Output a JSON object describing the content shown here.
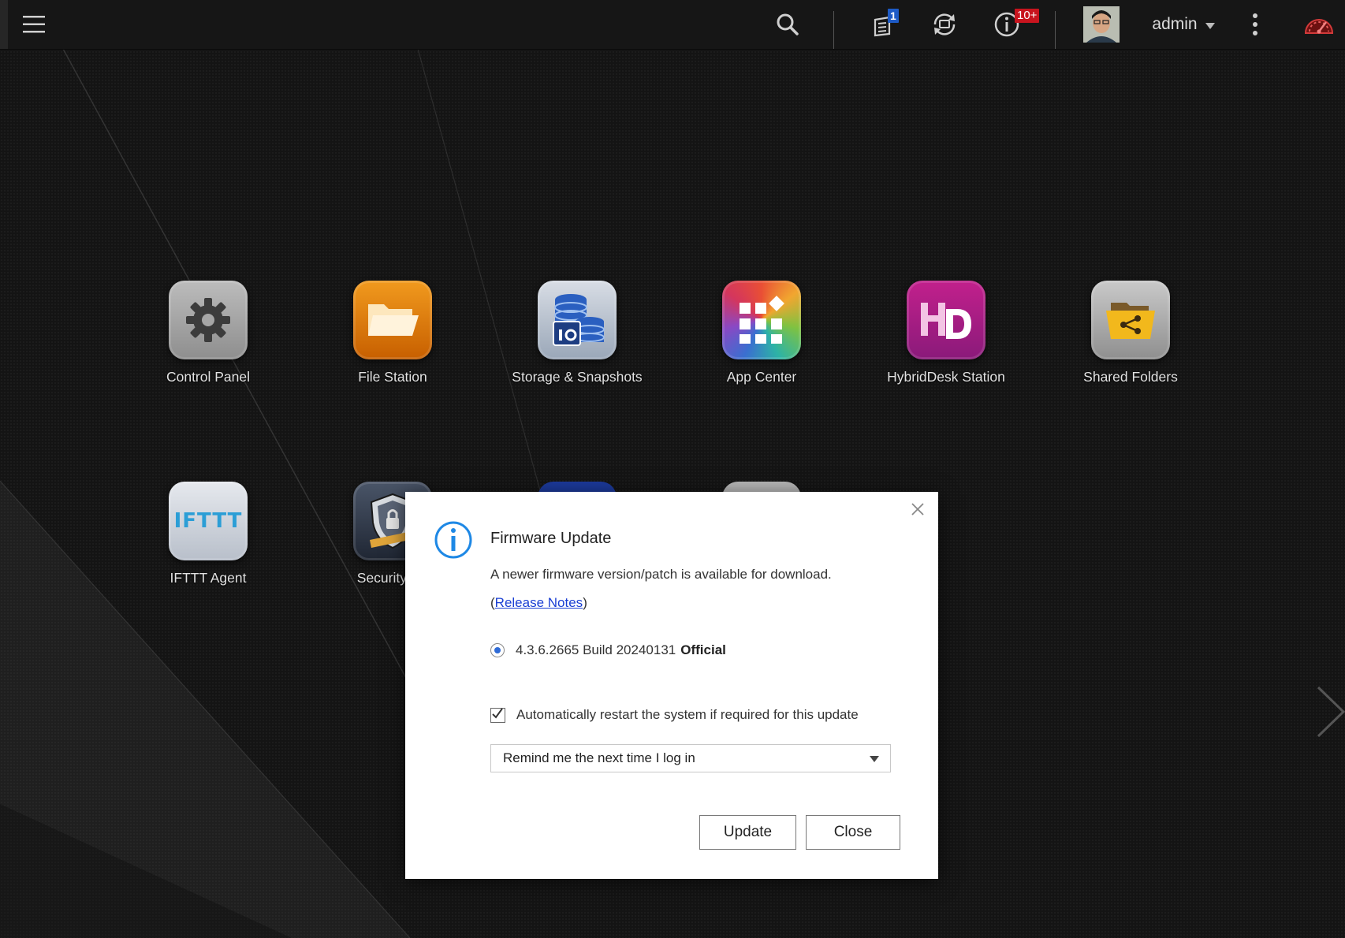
{
  "topbar": {
    "task_badge": "1",
    "notification_badge": "10+",
    "username": "admin",
    "icons": [
      "menu-icon",
      "search-icon",
      "background-tasks-icon",
      "sync-icon",
      "event-notifications-icon",
      "avatar",
      "more-options-icon",
      "dashboard-icon"
    ]
  },
  "apps": [
    {
      "label": "Control Panel"
    },
    {
      "label": "File Station"
    },
    {
      "label": "Storage & Snapshots"
    },
    {
      "label": "App Center"
    },
    {
      "label": "HybridDesk Station"
    },
    {
      "label": "Shared Folders"
    },
    {
      "label": "IFTTT Agent",
      "tile_text": "IFTTT"
    },
    {
      "label": "Security Co"
    }
  ],
  "dialog": {
    "title": "Firmware Update",
    "message": "A newer firmware version/patch is available for download.",
    "notes_open": "(",
    "notes_link": "Release Notes",
    "notes_close": ")",
    "version": "4.3.6.2665 Build 20240131",
    "version_tag": "Official",
    "auto_restart_label": "Automatically restart the system if required for this update",
    "remind_selected": "Remind me the next time I log in",
    "update_button": "Update",
    "close_button": "Close"
  },
  "colors": {
    "accent_blue": "#2f6bd6",
    "notification_red": "#c8141e",
    "task_badge_blue": "#1e5bc6"
  }
}
